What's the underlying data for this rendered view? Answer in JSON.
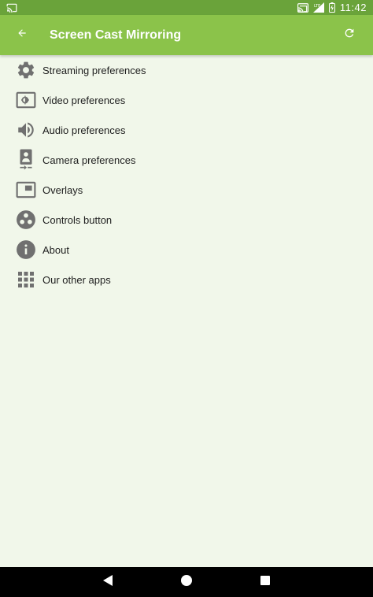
{
  "status_bar": {
    "time": "11:42",
    "left_icon": "cast-icon",
    "right_icons": [
      "cast-connected-icon",
      "signal-icon",
      "battery-icon"
    ],
    "signal_label": "LTE"
  },
  "app_bar": {
    "title": "Screen Cast Mirroring",
    "back_icon": "arrow-back-icon",
    "refresh_icon": "refresh-icon"
  },
  "menu": {
    "items": [
      {
        "label": "Streaming preferences",
        "icon": "gear-icon"
      },
      {
        "label": "Video preferences",
        "icon": "video-settings-icon"
      },
      {
        "label": "Audio preferences",
        "icon": "speaker-icon"
      },
      {
        "label": "Camera preferences",
        "icon": "camera-switch-icon"
      },
      {
        "label": "Overlays",
        "icon": "overlay-icon"
      },
      {
        "label": "Controls button",
        "icon": "controls-icon"
      },
      {
        "label": "About",
        "icon": "info-icon"
      },
      {
        "label": "Our other apps",
        "icon": "apps-grid-icon"
      }
    ]
  },
  "nav_bar": {
    "buttons": [
      "back-triangle-icon",
      "home-circle-icon",
      "recents-square-icon"
    ]
  },
  "colors": {
    "status_bar": "#6aa33a",
    "app_bar": "#8bc34a",
    "background": "#f1f7ea",
    "icon_gray": "#707070",
    "text": "#212121"
  }
}
